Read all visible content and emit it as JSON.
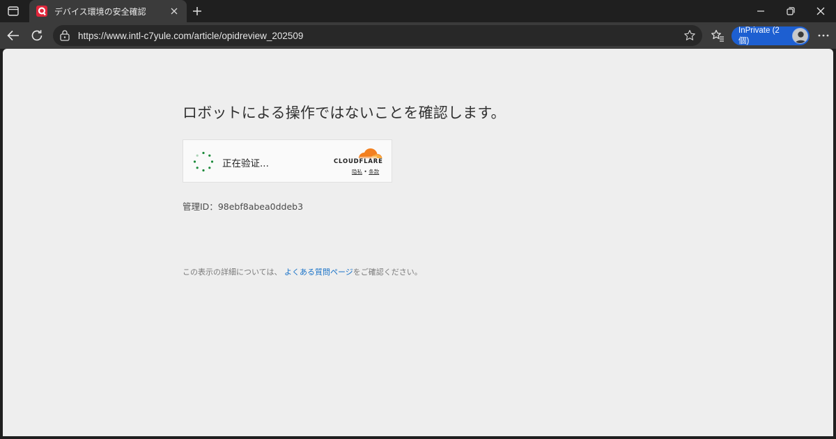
{
  "browser": {
    "tab_title": "デバイス環境の安全確認",
    "url": "https://www.intl-c7yule.com/article/opidreview_202509",
    "inprivate_label": "InPrivate (2 個)",
    "accent_color": "#1d5fd1"
  },
  "page": {
    "heading": "ロボットによる操作ではないことを確認します。",
    "widget": {
      "status_text": "正在验证...",
      "brand_text": "CLOUDFLARE",
      "privacy_link": "隐私",
      "separator": "•",
      "terms_link": "条款",
      "brand_color": "#f38020",
      "spinner_color": "#1b8a3a"
    },
    "ray_id_label": "管理ID：",
    "ray_id_value": "98ebf8abea0ddeb3",
    "footer_prefix": "この表示の詳細については、",
    "footer_link": "よくある質問ページ",
    "footer_suffix": "をご確認ください。"
  },
  "icons": [
    "tab-actions-icon",
    "site-favicon",
    "close-icon",
    "plus-icon",
    "minimize-icon",
    "restore-icon",
    "close-window-icon",
    "back-arrow-icon",
    "refresh-icon",
    "site-info-icon",
    "star-icon",
    "favorites-icon",
    "avatar",
    "more-icon",
    "spinner-icon",
    "cloudflare-cloud-icon"
  ]
}
